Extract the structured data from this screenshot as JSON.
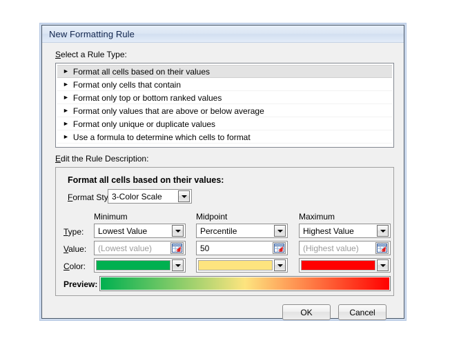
{
  "dialog": {
    "title": "New Formatting Rule",
    "sections": {
      "rule_type_label": "Select a Rule Type:",
      "rule_description_label": "Edit the Rule Description:"
    },
    "rule_types": [
      {
        "label": "Format all cells based on their values",
        "selected": true
      },
      {
        "label": "Format only cells that contain",
        "selected": false
      },
      {
        "label": "Format only top or bottom ranked values",
        "selected": false
      },
      {
        "label": "Format only values that are above or below average",
        "selected": false
      },
      {
        "label": "Format only unique or duplicate values",
        "selected": false
      },
      {
        "label": "Use a formula to determine which cells to format",
        "selected": false
      }
    ],
    "description": {
      "heading": "Format all cells based on their values:",
      "format_style_label": "Format Style:",
      "format_style_value": "3-Color Scale",
      "column_headers": {
        "minimum": "Minimum",
        "midpoint": "Midpoint",
        "maximum": "Maximum"
      },
      "row_labels": {
        "type": "Type:",
        "value": "Value:",
        "color": "Color:",
        "preview": "Preview:"
      },
      "type_row": {
        "minimum": "Lowest Value",
        "midpoint": "Percentile",
        "maximum": "Highest Value"
      },
      "value_row": {
        "minimum": "(Lowest value)",
        "minimum_is_placeholder": true,
        "midpoint": "50",
        "midpoint_is_placeholder": false,
        "maximum": "(Highest value)",
        "maximum_is_placeholder": true,
        "picker_icon": "range-selector-icon"
      },
      "color_row": {
        "minimum_color": "#00B050",
        "midpoint_color": "#FDE47F",
        "maximum_color": "#FF0000"
      },
      "preview_gradient": {
        "stops": [
          "#00B050",
          "#FDE47F",
          "#FF0000"
        ]
      }
    },
    "footer": {
      "ok_label": "OK",
      "cancel_label": "Cancel"
    }
  }
}
